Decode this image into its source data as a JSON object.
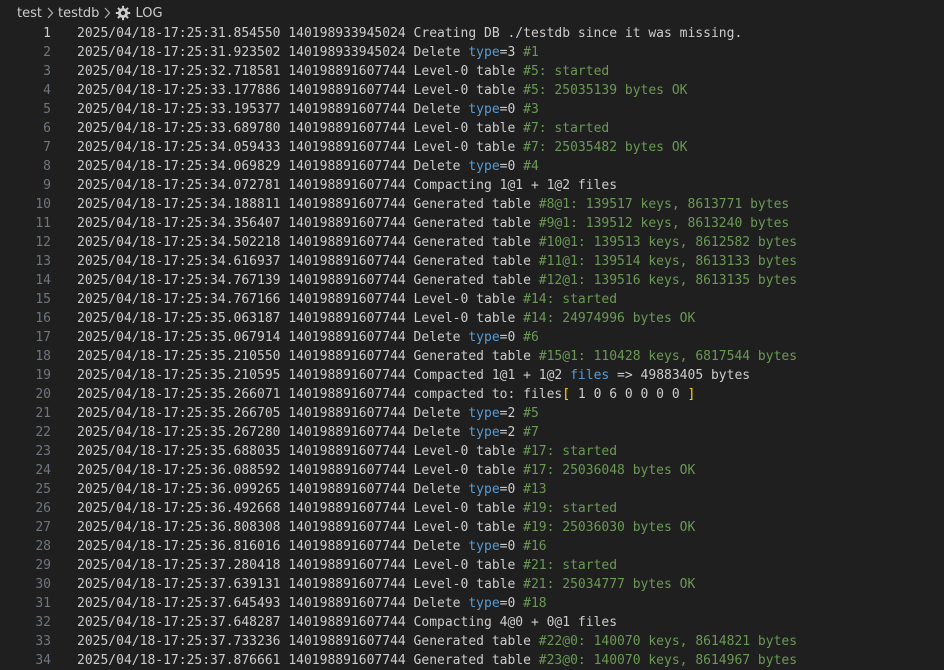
{
  "breadcrumb": {
    "items": [
      "test",
      "testdb",
      "LOG"
    ],
    "icon": "gear-icon"
  },
  "colors": {
    "background": "#1f1f1f",
    "text": "#cccccc",
    "line_number": "#6e7681",
    "keyword": "#569cd6",
    "comment": "#6a9955",
    "bracket": "#ffd700"
  },
  "editor": {
    "active_line": 1,
    "lines": [
      {
        "n": "1",
        "segs": [
          [
            "t",
            "2025/04/18-17:25:31.854550 140198933945024 Creating DB ./testdb since it was missing."
          ]
        ]
      },
      {
        "n": "2",
        "segs": [
          [
            "t",
            "2025/04/18-17:25:31.923502 140198933945024 Delete "
          ],
          [
            "k",
            "type"
          ],
          [
            "t",
            "=3 "
          ],
          [
            "g",
            "#1"
          ]
        ]
      },
      {
        "n": "3",
        "segs": [
          [
            "t",
            "2025/04/18-17:25:32.718581 140198891607744 Level-0 table "
          ],
          [
            "g",
            "#5: started"
          ]
        ]
      },
      {
        "n": "4",
        "segs": [
          [
            "t",
            "2025/04/18-17:25:33.177886 140198891607744 Level-0 table "
          ],
          [
            "g",
            "#5: 25035139 bytes OK"
          ]
        ]
      },
      {
        "n": "5",
        "segs": [
          [
            "t",
            "2025/04/18-17:25:33.195377 140198891607744 Delete "
          ],
          [
            "k",
            "type"
          ],
          [
            "t",
            "=0 "
          ],
          [
            "g",
            "#3"
          ]
        ]
      },
      {
        "n": "6",
        "segs": [
          [
            "t",
            "2025/04/18-17:25:33.689780 140198891607744 Level-0 table "
          ],
          [
            "g",
            "#7: started"
          ]
        ]
      },
      {
        "n": "7",
        "segs": [
          [
            "t",
            "2025/04/18-17:25:34.059433 140198891607744 Level-0 table "
          ],
          [
            "g",
            "#7: 25035482 bytes OK"
          ]
        ]
      },
      {
        "n": "8",
        "segs": [
          [
            "t",
            "2025/04/18-17:25:34.069829 140198891607744 Delete "
          ],
          [
            "k",
            "type"
          ],
          [
            "t",
            "=0 "
          ],
          [
            "g",
            "#4"
          ]
        ]
      },
      {
        "n": "9",
        "segs": [
          [
            "t",
            "2025/04/18-17:25:34.072781 140198891607744 Compacting 1@1 + 1@2 files"
          ]
        ]
      },
      {
        "n": "10",
        "segs": [
          [
            "t",
            "2025/04/18-17:25:34.188811 140198891607744 Generated table "
          ],
          [
            "g",
            "#8@1: 139517 keys, 8613771 bytes"
          ]
        ]
      },
      {
        "n": "11",
        "segs": [
          [
            "t",
            "2025/04/18-17:25:34.356407 140198891607744 Generated table "
          ],
          [
            "g",
            "#9@1: 139512 keys, 8613240 bytes"
          ]
        ]
      },
      {
        "n": "12",
        "segs": [
          [
            "t",
            "2025/04/18-17:25:34.502218 140198891607744 Generated table "
          ],
          [
            "g",
            "#10@1: 139513 keys, 8612582 bytes"
          ]
        ]
      },
      {
        "n": "13",
        "segs": [
          [
            "t",
            "2025/04/18-17:25:34.616937 140198891607744 Generated table "
          ],
          [
            "g",
            "#11@1: 139514 keys, 8613133 bytes"
          ]
        ]
      },
      {
        "n": "14",
        "segs": [
          [
            "t",
            "2025/04/18-17:25:34.767139 140198891607744 Generated table "
          ],
          [
            "g",
            "#12@1: 139516 keys, 8613135 bytes"
          ]
        ]
      },
      {
        "n": "15",
        "segs": [
          [
            "t",
            "2025/04/18-17:25:34.767166 140198891607744 Level-0 table "
          ],
          [
            "g",
            "#14: started"
          ]
        ]
      },
      {
        "n": "16",
        "segs": [
          [
            "t",
            "2025/04/18-17:25:35.063187 140198891607744 Level-0 table "
          ],
          [
            "g",
            "#14: 24974996 bytes OK"
          ]
        ]
      },
      {
        "n": "17",
        "segs": [
          [
            "t",
            "2025/04/18-17:25:35.067914 140198891607744 Delete "
          ],
          [
            "k",
            "type"
          ],
          [
            "t",
            "=0 "
          ],
          [
            "g",
            "#6"
          ]
        ]
      },
      {
        "n": "18",
        "segs": [
          [
            "t",
            "2025/04/18-17:25:35.210550 140198891607744 Generated table "
          ],
          [
            "g",
            "#15@1: 110428 keys, 6817544 bytes"
          ]
        ]
      },
      {
        "n": "19",
        "segs": [
          [
            "t",
            "2025/04/18-17:25:35.210595 140198891607744 Compacted 1@1 + 1@2 "
          ],
          [
            "k",
            "files"
          ],
          [
            "t",
            " => 49883405 bytes"
          ]
        ]
      },
      {
        "n": "20",
        "segs": [
          [
            "t",
            "2025/04/18-17:25:35.266071 140198891607744 compacted to: files"
          ],
          [
            "b",
            "["
          ],
          [
            "t",
            " 1 0 6 0 0 0 0 "
          ],
          [
            "b",
            "]"
          ]
        ]
      },
      {
        "n": "21",
        "segs": [
          [
            "t",
            "2025/04/18-17:25:35.266705 140198891607744 Delete "
          ],
          [
            "k",
            "type"
          ],
          [
            "t",
            "=2 "
          ],
          [
            "g",
            "#5"
          ]
        ]
      },
      {
        "n": "22",
        "segs": [
          [
            "t",
            "2025/04/18-17:25:35.267280 140198891607744 Delete "
          ],
          [
            "k",
            "type"
          ],
          [
            "t",
            "=2 "
          ],
          [
            "g",
            "#7"
          ]
        ]
      },
      {
        "n": "23",
        "segs": [
          [
            "t",
            "2025/04/18-17:25:35.688035 140198891607744 Level-0 table "
          ],
          [
            "g",
            "#17: started"
          ]
        ]
      },
      {
        "n": "24",
        "segs": [
          [
            "t",
            "2025/04/18-17:25:36.088592 140198891607744 Level-0 table "
          ],
          [
            "g",
            "#17: 25036048 bytes OK"
          ]
        ]
      },
      {
        "n": "25",
        "segs": [
          [
            "t",
            "2025/04/18-17:25:36.099265 140198891607744 Delete "
          ],
          [
            "k",
            "type"
          ],
          [
            "t",
            "=0 "
          ],
          [
            "g",
            "#13"
          ]
        ]
      },
      {
        "n": "26",
        "segs": [
          [
            "t",
            "2025/04/18-17:25:36.492668 140198891607744 Level-0 table "
          ],
          [
            "g",
            "#19: started"
          ]
        ]
      },
      {
        "n": "27",
        "segs": [
          [
            "t",
            "2025/04/18-17:25:36.808308 140198891607744 Level-0 table "
          ],
          [
            "g",
            "#19: 25036030 bytes OK"
          ]
        ]
      },
      {
        "n": "28",
        "segs": [
          [
            "t",
            "2025/04/18-17:25:36.816016 140198891607744 Delete "
          ],
          [
            "k",
            "type"
          ],
          [
            "t",
            "=0 "
          ],
          [
            "g",
            "#16"
          ]
        ]
      },
      {
        "n": "29",
        "segs": [
          [
            "t",
            "2025/04/18-17:25:37.280418 140198891607744 Level-0 table "
          ],
          [
            "g",
            "#21: started"
          ]
        ]
      },
      {
        "n": "30",
        "segs": [
          [
            "t",
            "2025/04/18-17:25:37.639131 140198891607744 Level-0 table "
          ],
          [
            "g",
            "#21: 25034777 bytes OK"
          ]
        ]
      },
      {
        "n": "31",
        "segs": [
          [
            "t",
            "2025/04/18-17:25:37.645493 140198891607744 Delete "
          ],
          [
            "k",
            "type"
          ],
          [
            "t",
            "=0 "
          ],
          [
            "g",
            "#18"
          ]
        ]
      },
      {
        "n": "32",
        "segs": [
          [
            "t",
            "2025/04/18-17:25:37.648287 140198891607744 Compacting 4@0 + 0@1 files"
          ]
        ]
      },
      {
        "n": "33",
        "segs": [
          [
            "t",
            "2025/04/18-17:25:37.733236 140198891607744 Generated table "
          ],
          [
            "g",
            "#22@0: 140070 keys, 8614821 bytes"
          ]
        ]
      },
      {
        "n": "34",
        "segs": [
          [
            "t",
            "2025/04/18-17:25:37.876661 140198891607744 Generated table "
          ],
          [
            "g",
            "#23@0: 140070 keys, 8614967 bytes"
          ]
        ]
      }
    ]
  }
}
